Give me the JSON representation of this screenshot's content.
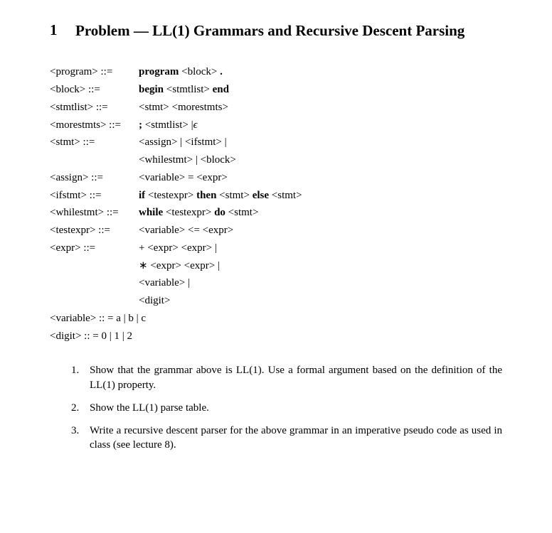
{
  "section": {
    "number": "1",
    "title": "Problem — LL(1) Grammars and Recursive Descent Parsing"
  },
  "grammar": {
    "rules": [
      {
        "lhs": "<program> ::=",
        "rhs_parts": [
          [
            "b",
            "program"
          ],
          [
            "t",
            " "
          ],
          [
            "n",
            "<block>"
          ],
          [
            "t",
            " "
          ],
          [
            "b",
            "."
          ]
        ]
      },
      {
        "lhs": "<block> ::=",
        "rhs_parts": [
          [
            "b",
            "begin"
          ],
          [
            "t",
            " "
          ],
          [
            "n",
            "<stmtlist>"
          ],
          [
            "t",
            " "
          ],
          [
            "b",
            "end"
          ]
        ]
      },
      {
        "lhs": "<stmtlist> ::=",
        "rhs_parts": [
          [
            "n",
            "<stmt>"
          ],
          [
            "t",
            " "
          ],
          [
            "n",
            "<morestmts>"
          ]
        ]
      },
      {
        "lhs": "<morestmts> ::=",
        "rhs_parts": [
          [
            "b",
            ";"
          ],
          [
            "t",
            " "
          ],
          [
            "n",
            "<stmtlist>"
          ],
          [
            "t",
            " |"
          ],
          [
            "e",
            "ε"
          ]
        ]
      },
      {
        "lhs": "<stmt> ::=",
        "rhs_parts": [
          [
            "n",
            "<assign>"
          ],
          [
            "t",
            " | "
          ],
          [
            "n",
            "<ifstmt>"
          ],
          [
            "t",
            " |"
          ]
        ]
      },
      {
        "lhs": "",
        "indent": true,
        "rhs_parts": [
          [
            "n",
            "<whilestmt>"
          ],
          [
            "t",
            " | "
          ],
          [
            "n",
            "<block>"
          ]
        ]
      },
      {
        "lhs": "<assign> ::=",
        "rhs_parts": [
          [
            "n",
            "<variable>"
          ],
          [
            "t",
            " = "
          ],
          [
            "n",
            "<expr>"
          ]
        ]
      },
      {
        "lhs": "<ifstmt> ::=",
        "rhs_parts": [
          [
            "b",
            "if"
          ],
          [
            "t",
            " "
          ],
          [
            "n",
            "<testexpr>"
          ],
          [
            "t",
            " "
          ],
          [
            "b",
            "then"
          ],
          [
            "t",
            " "
          ],
          [
            "n",
            "<stmt>"
          ],
          [
            "t",
            " "
          ],
          [
            "b",
            "else"
          ],
          [
            "t",
            " "
          ],
          [
            "n",
            "<stmt>"
          ]
        ]
      },
      {
        "lhs": "<whilestmt> ::=",
        "rhs_parts": [
          [
            "b",
            "while"
          ],
          [
            "t",
            " "
          ],
          [
            "n",
            "<testexpr>"
          ],
          [
            "t",
            " "
          ],
          [
            "b",
            "do"
          ],
          [
            "t",
            " "
          ],
          [
            "n",
            "<stmt>"
          ]
        ]
      },
      {
        "lhs": "<testexpr> ::=",
        "rhs_parts": [
          [
            "n",
            "<variable>"
          ],
          [
            "t",
            " <=  "
          ],
          [
            "n",
            "<expr>"
          ]
        ]
      },
      {
        "lhs": "<expr> ::=",
        "rhs_parts": [
          [
            "t",
            "+ "
          ],
          [
            "n",
            "<expr>"
          ],
          [
            "t",
            " "
          ],
          [
            "n",
            "<expr>"
          ],
          [
            "t",
            " |"
          ]
        ]
      },
      {
        "lhs": "",
        "indent": true,
        "rhs_parts": [
          [
            "t",
            "∗ "
          ],
          [
            "n",
            "<expr>"
          ],
          [
            "t",
            " "
          ],
          [
            "n",
            "<expr>"
          ],
          [
            "t",
            " |"
          ]
        ]
      },
      {
        "lhs": "",
        "indent": true,
        "rhs_parts": [
          [
            "n",
            "<variable>"
          ],
          [
            "t",
            " |"
          ]
        ]
      },
      {
        "lhs": "",
        "indent": true,
        "rhs_parts": [
          [
            "n",
            "<digit>"
          ]
        ]
      },
      {
        "lhs_full": "<variable> :: = a | b | c"
      },
      {
        "lhs_full": "<digit> :: = 0 | 1 | 2"
      }
    ]
  },
  "questions": [
    {
      "num": "1.",
      "text": "Show that the grammar above is LL(1). Use a formal argument based on the definition of the LL(1) property."
    },
    {
      "num": "2.",
      "text": "Show the LL(1) parse table."
    },
    {
      "num": "3.",
      "text": "Write a recursive descent parser for the above grammar in an imperative pseudo code as used in class (see lecture 8)."
    }
  ]
}
